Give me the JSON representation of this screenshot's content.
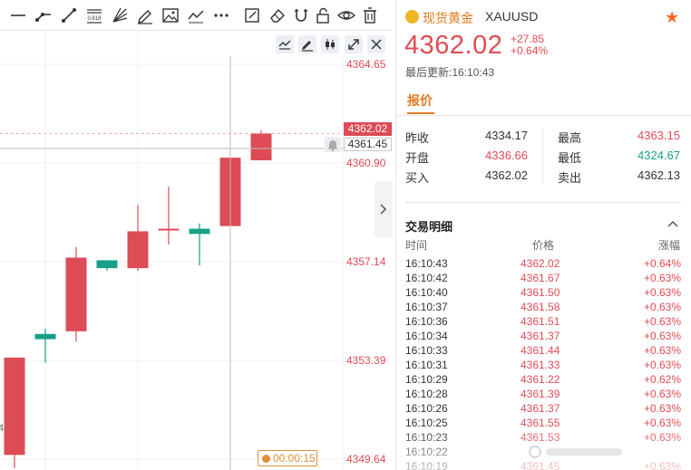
{
  "toolbar": {
    "tools": [
      "horizontal-line-icon",
      "ray-icon",
      "trend-line-icon",
      "fibonacci-icon",
      "fan-icon",
      "brush-icon",
      "image-icon",
      "polyline-icon",
      "more-icon",
      "note-icon",
      "eraser-icon",
      "magnet-icon",
      "lock-icon",
      "eye-icon",
      "trash-icon"
    ],
    "fib_label": "0.618"
  },
  "chart": {
    "price_axis": [
      "4364.65",
      "4360.90",
      "4357.14",
      "4353.39",
      "4349.64"
    ],
    "last_price_tag": "4362.02",
    "crosshair_price": "4361.45",
    "partial_label": "4",
    "timer": "00:00:15",
    "colors": {
      "up": "#dd4b55",
      "down": "#17a086"
    },
    "candles": [
      {
        "o": 4349.8,
        "h": 4353.5,
        "l": 4349.3,
        "c": 4353.5
      },
      {
        "o": 4354.4,
        "h": 4354.6,
        "l": 4353.3,
        "c": 4354.2
      },
      {
        "o": 4354.5,
        "h": 4357.7,
        "l": 4354.1,
        "c": 4357.3
      },
      {
        "o": 4357.2,
        "h": 4357.2,
        "l": 4356.8,
        "c": 4356.9
      },
      {
        "o": 4356.9,
        "h": 4359.3,
        "l": 4356.8,
        "c": 4358.3
      },
      {
        "o": 4358.4,
        "h": 4360.0,
        "l": 4357.8,
        "c": 4358.4
      },
      {
        "o": 4358.4,
        "h": 4358.6,
        "l": 4357.0,
        "c": 4358.2
      },
      {
        "o": 4358.5,
        "h": 4361.1,
        "l": 4358.5,
        "c": 4361.1
      },
      {
        "o": 4361.0,
        "h": 4362.15,
        "l": 4361.0,
        "c": 4362.02
      }
    ]
  },
  "quote": {
    "name": "现货黄金",
    "code": "XAUUSD",
    "price": "4362.02",
    "change_abs": "+27.85",
    "change_pct": "+0.64%",
    "updated": "最后更新:16:10:43",
    "tab": "报价",
    "stats": {
      "prev_close_label": "昨收",
      "prev_close": "4334.17",
      "open_label": "开盘",
      "open": "4336.66",
      "bid_label": "买入",
      "bid": "4362.02",
      "high_label": "最高",
      "high": "4363.15",
      "low_label": "最低",
      "low": "4324.67",
      "ask_label": "卖出",
      "ask": "4362.13"
    }
  },
  "trades": {
    "title": "交易明细",
    "col_time": "时间",
    "col_price": "价格",
    "col_change": "涨幅",
    "rows": [
      {
        "time": "16:10:43",
        "price": "4362.02",
        "change": "+0.64%"
      },
      {
        "time": "16:10:42",
        "price": "4361.67",
        "change": "+0.63%"
      },
      {
        "time": "16:10:40",
        "price": "4361.50",
        "change": "+0.63%"
      },
      {
        "time": "16:10:37",
        "price": "4361.58",
        "change": "+0.63%"
      },
      {
        "time": "16:10:36",
        "price": "4361.51",
        "change": "+0.63%"
      },
      {
        "time": "16:10:34",
        "price": "4361.37",
        "change": "+0.63%"
      },
      {
        "time": "16:10:33",
        "price": "4361.44",
        "change": "+0.63%"
      },
      {
        "time": "16:10:31",
        "price": "4361.33",
        "change": "+0.63%"
      },
      {
        "time": "16:10:29",
        "price": "4361.22",
        "change": "+0.62%"
      },
      {
        "time": "16:10:28",
        "price": "4361.39",
        "change": "+0.63%"
      },
      {
        "time": "16:10:26",
        "price": "4361.37",
        "change": "+0.63%"
      },
      {
        "time": "16:10:25",
        "price": "4361.55",
        "change": "+0.63%"
      },
      {
        "time": "16:10:23",
        "price": "4361.53",
        "change": "+0.63%"
      },
      {
        "time": "16:10:22",
        "price": "",
        "change": ""
      },
      {
        "time": "16:10:19",
        "price": "4361.45",
        "change": "+0.63%"
      }
    ]
  }
}
